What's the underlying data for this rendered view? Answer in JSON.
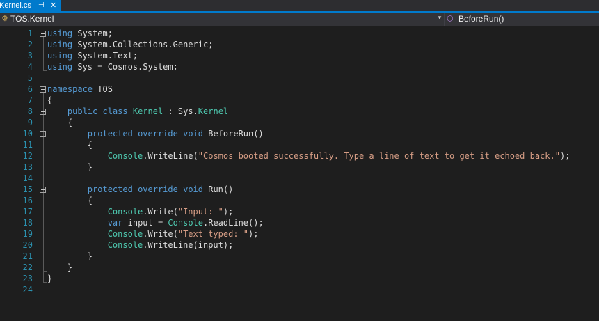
{
  "tab": {
    "label": "Kernel.cs",
    "pin_icon": "pin-icon",
    "close_icon": "close-icon"
  },
  "nav": {
    "left_label": "TOS.Kernel",
    "right_label": "BeforeRun()"
  },
  "colors": {
    "keyword": "#569cd6",
    "type": "#4ec9b0",
    "string": "#d69d85",
    "line_number": "#2b91af",
    "accent": "#007acc"
  },
  "code": {
    "lines": [
      {
        "n": "1",
        "tokens": [
          {
            "t": "using",
            "c": "kw"
          },
          {
            "t": " System;"
          }
        ]
      },
      {
        "n": "2",
        "tokens": [
          {
            "t": "using",
            "c": "kw"
          },
          {
            "t": " System.Collections.Generic;"
          }
        ]
      },
      {
        "n": "3",
        "tokens": [
          {
            "t": "using",
            "c": "kw"
          },
          {
            "t": " System.Text;"
          }
        ]
      },
      {
        "n": "4",
        "tokens": [
          {
            "t": "using",
            "c": "kw"
          },
          {
            "t": " Sys = Cosmos.System;"
          }
        ]
      },
      {
        "n": "5",
        "tokens": []
      },
      {
        "n": "6",
        "tokens": [
          {
            "t": "namespace",
            "c": "kw"
          },
          {
            "t": " TOS"
          }
        ]
      },
      {
        "n": "7",
        "tokens": [
          {
            "t": "{"
          }
        ]
      },
      {
        "n": "8",
        "tokens": [
          {
            "t": "    "
          },
          {
            "t": "public",
            "c": "kw"
          },
          {
            "t": " "
          },
          {
            "t": "class",
            "c": "kw"
          },
          {
            "t": " "
          },
          {
            "t": "Kernel",
            "c": "ty"
          },
          {
            "t": " : Sys."
          },
          {
            "t": "Kernel",
            "c": "ty"
          }
        ]
      },
      {
        "n": "9",
        "tokens": [
          {
            "t": "    {"
          }
        ]
      },
      {
        "n": "10",
        "tokens": [
          {
            "t": "        "
          },
          {
            "t": "protected",
            "c": "kw"
          },
          {
            "t": " "
          },
          {
            "t": "override",
            "c": "kw"
          },
          {
            "t": " "
          },
          {
            "t": "void",
            "c": "kw"
          },
          {
            "t": " BeforeRun()"
          }
        ]
      },
      {
        "n": "11",
        "tokens": [
          {
            "t": "        {"
          }
        ]
      },
      {
        "n": "12",
        "tokens": [
          {
            "t": "            "
          },
          {
            "t": "Console",
            "c": "ty"
          },
          {
            "t": ".WriteLine("
          },
          {
            "t": "\"Cosmos booted successfully. Type a line of text to get it echoed back.\"",
            "c": "str"
          },
          {
            "t": ");"
          }
        ]
      },
      {
        "n": "13",
        "tokens": [
          {
            "t": "        }"
          }
        ]
      },
      {
        "n": "14",
        "tokens": []
      },
      {
        "n": "15",
        "tokens": [
          {
            "t": "        "
          },
          {
            "t": "protected",
            "c": "kw"
          },
          {
            "t": " "
          },
          {
            "t": "override",
            "c": "kw"
          },
          {
            "t": " "
          },
          {
            "t": "void",
            "c": "kw"
          },
          {
            "t": " Run()"
          }
        ]
      },
      {
        "n": "16",
        "tokens": [
          {
            "t": "        {"
          }
        ]
      },
      {
        "n": "17",
        "tokens": [
          {
            "t": "            "
          },
          {
            "t": "Console",
            "c": "ty"
          },
          {
            "t": ".Write("
          },
          {
            "t": "\"Input: \"",
            "c": "str"
          },
          {
            "t": ");"
          }
        ]
      },
      {
        "n": "18",
        "tokens": [
          {
            "t": "            "
          },
          {
            "t": "var",
            "c": "kw"
          },
          {
            "t": " input = "
          },
          {
            "t": "Console",
            "c": "ty"
          },
          {
            "t": ".ReadLine();"
          }
        ]
      },
      {
        "n": "19",
        "tokens": [
          {
            "t": "            "
          },
          {
            "t": "Console",
            "c": "ty"
          },
          {
            "t": ".Write("
          },
          {
            "t": "\"Text typed: \"",
            "c": "str"
          },
          {
            "t": ");"
          }
        ]
      },
      {
        "n": "20",
        "tokens": [
          {
            "t": "            "
          },
          {
            "t": "Console",
            "c": "ty"
          },
          {
            "t": ".WriteLine(input);"
          }
        ]
      },
      {
        "n": "21",
        "tokens": [
          {
            "t": "        }"
          }
        ]
      },
      {
        "n": "22",
        "tokens": [
          {
            "t": "    }"
          }
        ]
      },
      {
        "n": "23",
        "tokens": [
          {
            "t": "}"
          }
        ]
      },
      {
        "n": "24",
        "tokens": []
      }
    ]
  }
}
